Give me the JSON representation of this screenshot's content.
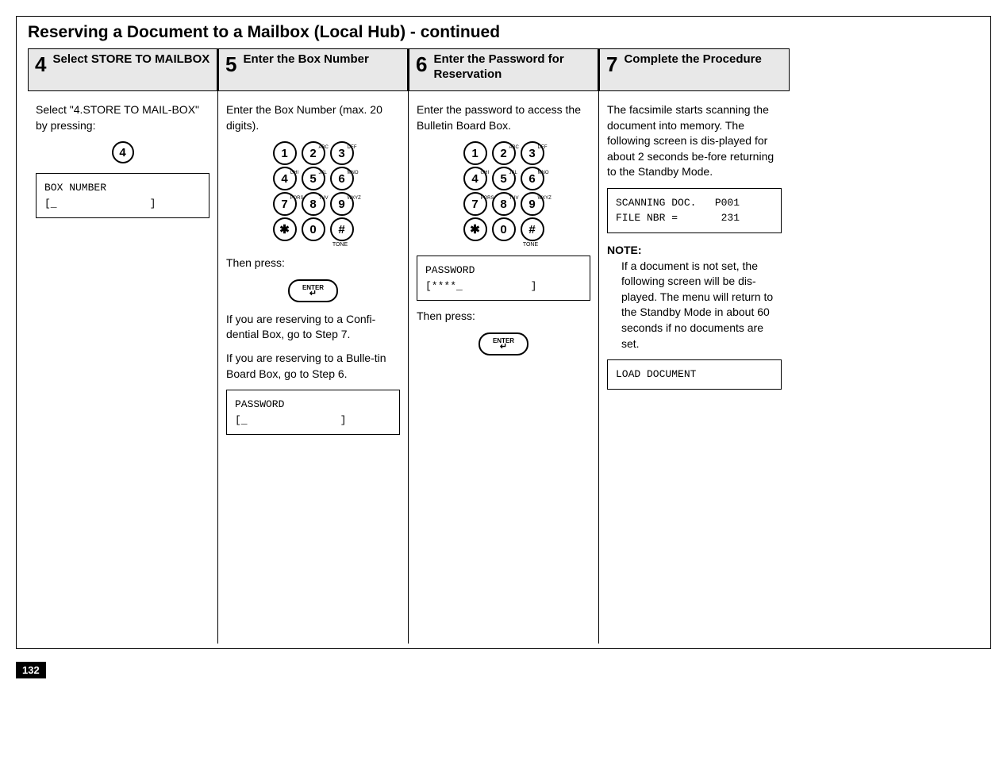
{
  "page_title": "Reserving a Document to a Mailbox (Local Hub) - continued",
  "page_number": "132",
  "steps": {
    "s4": {
      "num": "4",
      "title": "Select STORE TO MAILBOX",
      "instr": "Select \"4.STORE TO MAIL-BOX\" by pressing:",
      "key": "4",
      "lcd": "BOX NUMBER\n[_               ]"
    },
    "s5": {
      "num": "5",
      "title": "Enter the Box Number",
      "instr1": "Enter the Box Number (max. 20 digits).",
      "then": "Then press:",
      "enter": "ENTER",
      "note1": "If you are reserving to a Confi-dential Box, go to Step 7.",
      "note2": "If you are reserving to a Bulle-tin Board Box, go to Step 6.",
      "lcd": "PASSWORD\n[_               ]"
    },
    "s6": {
      "num": "6",
      "title": "Enter the Password for Reservation",
      "instr1": "Enter the password to access the Bulletin Board Box.",
      "lcd": "PASSWORD\n[****_           ]",
      "then": "Then press:",
      "enter": "ENTER"
    },
    "s7": {
      "num": "7",
      "title": "Complete the Procedure",
      "instr1": "The facsimile starts scanning the document into memory. The following screen is dis-played for about 2 seconds be-fore returning to the Standby Mode.",
      "lcd1": "SCANNING DOC.   P001\nFILE NBR =       231",
      "note_label": "NOTE:",
      "note_body": "If a document is not set, the following screen will be dis-played. The menu will return to the Standby Mode in about 60 seconds if no documents are set.",
      "lcd2": "LOAD DOCUMENT"
    }
  },
  "keypad": {
    "row1": [
      {
        "d": "1",
        "sup": ""
      },
      {
        "d": "2",
        "sup": "ABC"
      },
      {
        "d": "3",
        "sup": "DEF"
      }
    ],
    "row2": [
      {
        "d": "4",
        "sup": "GHI"
      },
      {
        "d": "5",
        "sup": "JKL"
      },
      {
        "d": "6",
        "sup": "MNO"
      }
    ],
    "row3": [
      {
        "d": "7",
        "sup": "PQRS"
      },
      {
        "d": "8",
        "sup": "TUV"
      },
      {
        "d": "9",
        "sup": "WXYZ"
      }
    ],
    "row4": [
      {
        "d": "✱",
        "sup": ""
      },
      {
        "d": "0",
        "sup": ""
      },
      {
        "d": "#",
        "sup": ""
      }
    ],
    "tone": "TONE"
  }
}
